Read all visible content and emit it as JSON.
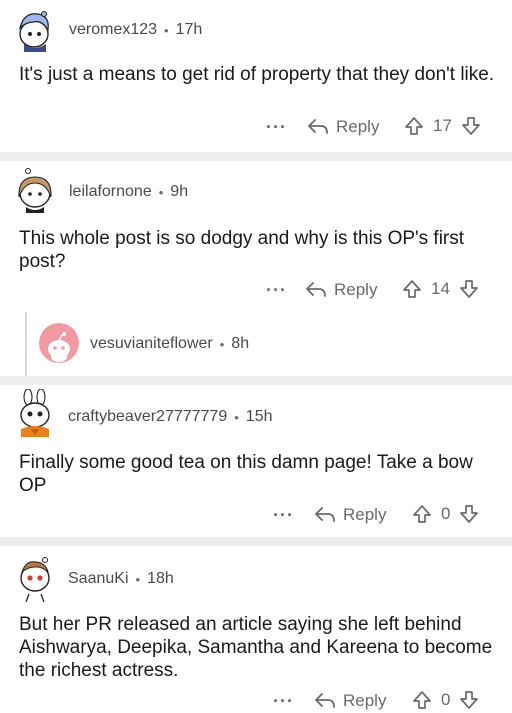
{
  "comments": [
    {
      "username": "veromex123",
      "time": "17h",
      "text": "It's just a means to get rid of property that they don't like.",
      "more": "...",
      "reply_label": "Reply",
      "votes": "17",
      "avatar_icon": "snoo-avatar-blue-hair"
    },
    {
      "username": "leilafornone",
      "time": "9h",
      "text": "This whole post is so dodgy and why is this OP's first post?",
      "more": "...",
      "reply_label": "Reply",
      "votes": "14",
      "avatar_icon": "snoo-avatar-brown-hair"
    },
    {
      "username": "vesuvianiteflower",
      "time": "8h",
      "avatar_icon": "snoo-avatar-default-pink"
    },
    {
      "username": "craftybeaver27777779",
      "time": "15h",
      "text": "Finally some good tea on this damn page! Take a bow OP",
      "more": "...",
      "reply_label": "Reply",
      "votes": "0",
      "avatar_icon": "snoo-avatar-bunny-orange"
    },
    {
      "username": "SaanuKi",
      "time": "18h",
      "text": "But her PR released an article saying she left behind Aishwarya, Deepika, Samantha and Kareena to become the richest actress.",
      "more": "...",
      "reply_label": "Reply",
      "votes": "0",
      "avatar_icon": "snoo-avatar-red-eyes"
    }
  ],
  "colors": {
    "separator": "#ededed",
    "meta_text": "#4a4a4a",
    "action_text": "#6a6a6a",
    "body_text": "#1a1a1b",
    "thread_line": "#d9d9d9"
  }
}
